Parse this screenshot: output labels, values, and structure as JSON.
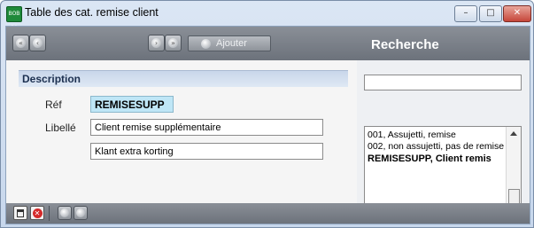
{
  "window": {
    "title": "Table des cat. remise client",
    "app_icon_text": "BOB 50",
    "icons": {
      "app": "bob-app-icon",
      "minimize": "minimize-icon",
      "maximize": "maximize-icon",
      "close": "close-icon"
    },
    "minimize_glyph": "–",
    "maximize_glyph": "□",
    "close_glyph": "✕"
  },
  "toolbar": {
    "ajouter_label": "Ajouter",
    "search_title": "Recherche",
    "nav_icons": [
      "first-record-icon",
      "previous-record-icon",
      "next-record-icon",
      "last-record-icon"
    ]
  },
  "description": {
    "section_title": "Description",
    "ref_label": "Réf",
    "ref_value": "REMISESUPP",
    "libelle_label": "Libellé",
    "libelle_value": "Client remise supplémentaire",
    "libelle_alt_value": "Klant extra korting"
  },
  "search": {
    "input_value": "",
    "results": [
      {
        "text": "001, Assujetti, remise",
        "selected": false
      },
      {
        "text": "002, non assujetti, pas de remise",
        "selected": false
      },
      {
        "text": "REMISESUPP, Client remis",
        "selected": true
      }
    ]
  },
  "bottom_bar": {
    "icons": [
      "save-icon",
      "cancel-icon",
      "previous-icon",
      "next-icon"
    ],
    "cancel_glyph": "✕"
  },
  "colors": {
    "toolbar_bg": "#7a7f87",
    "ref_field_bg": "#bfe6f6",
    "section_header_bg": "#d3dfef",
    "section_title_color": "#1c3050",
    "close_button": "#c6463a"
  }
}
